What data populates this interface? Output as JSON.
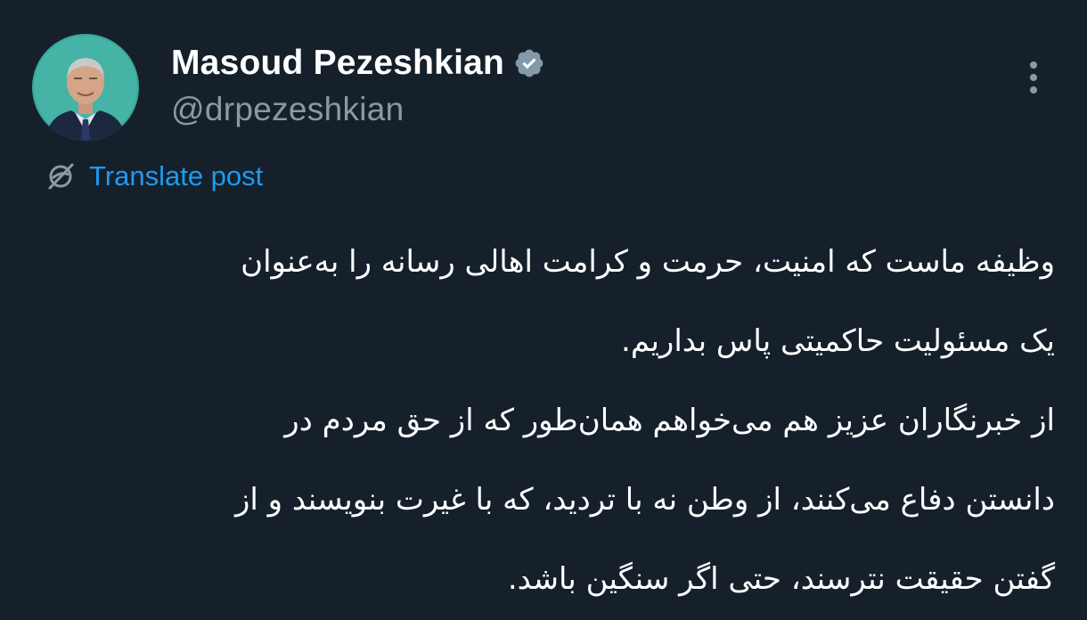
{
  "post": {
    "display_name": "Masoud Pezeshkian",
    "handle": "@drpezeshkian",
    "verified_icon": "verified-badge-icon",
    "more_icon": "more-options-icon",
    "translate_label": "Translate post",
    "translate_icon": "translate-globe-icon",
    "body_lines": [
      "وظیفه ماست که امنیت، حرمت و کرامت اهالی رسانه را به‌عنوان",
      "یک مسئولیت حاکمیتی پاس بداریم.",
      "از خبرنگاران عزیز هم می‌خواهم همان‌طور که از حق مردم در",
      "دانستن دفاع می‌کنند، از وطن نه با تردید، که با غیرت بنویسند و از",
      "گفتن حقیقت نترسند، حتی اگر سنگین باشد."
    ]
  },
  "colors": {
    "background": "#15202b",
    "primary_text": "#ffffff",
    "secondary_text": "#8b98a5",
    "link": "#1d9bf0",
    "avatar_bg": "#3aa59a"
  }
}
